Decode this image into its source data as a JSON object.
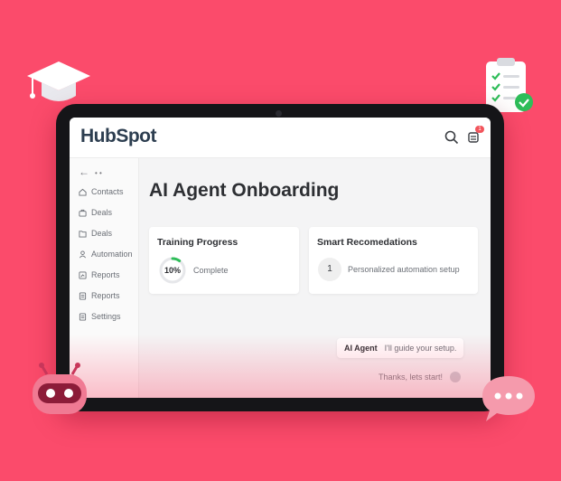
{
  "app": {
    "brand": "HubSpot",
    "brand_color": "#ff5c35"
  },
  "header": {
    "search_icon": "search-icon",
    "notifications_icon": "bell-icon",
    "notification_count": "1"
  },
  "sidebar": {
    "items": [
      {
        "label": "Contacts",
        "icon": "home-icon"
      },
      {
        "label": "Deals",
        "icon": "briefcase-icon"
      },
      {
        "label": "Deals",
        "icon": "folder-icon"
      },
      {
        "label": "Automation",
        "icon": "person-icon"
      },
      {
        "label": "Reports",
        "icon": "chart-icon"
      },
      {
        "label": "Reports",
        "icon": "document-icon"
      },
      {
        "label": "Settings",
        "icon": "document-icon"
      }
    ]
  },
  "main": {
    "title": "AI Agent Onboarding",
    "training": {
      "title": "Training Progress",
      "percent_label": "10%",
      "progress": 0.1,
      "status": "Complete"
    },
    "recommendations": {
      "title": "Smart Recomedations",
      "number": "1",
      "text": "Personalized automation setup"
    },
    "chat": {
      "ai_name": "AI Agent",
      "ai_message": "I'll guide your setup.",
      "user_message": "Thanks, lets start!"
    }
  },
  "colors": {
    "background": "#fb4b6b",
    "progress_ring": "#2ebd59"
  }
}
